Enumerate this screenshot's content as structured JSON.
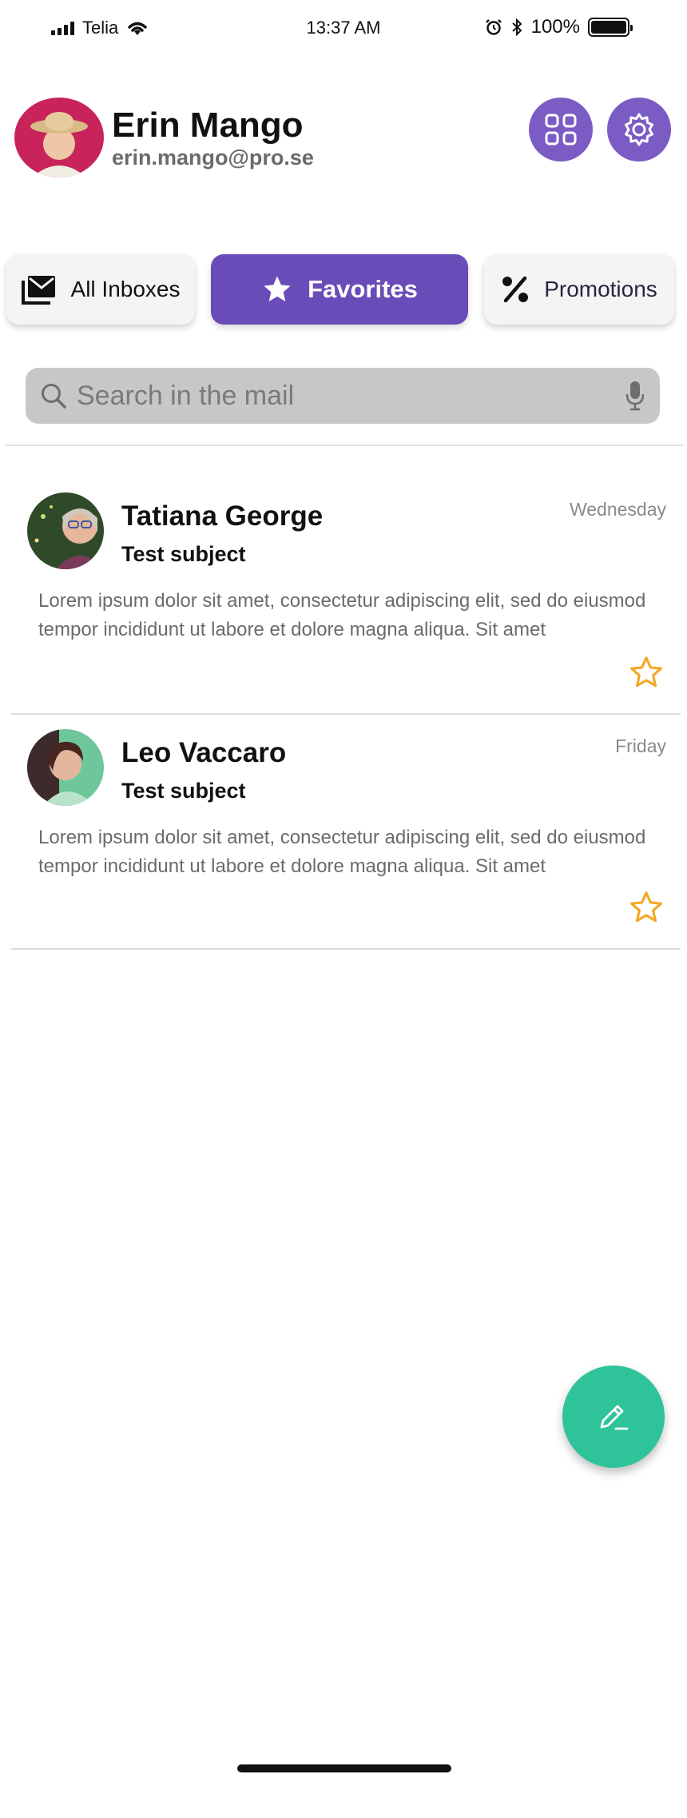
{
  "status_bar": {
    "carrier": "Telia",
    "time": "13:37 AM",
    "battery": "100%",
    "battery_level": 1.0
  },
  "header": {
    "name": "Erin Mango",
    "email": "erin.mango@pro.se",
    "icons": [
      "grid-icon",
      "gear-icon"
    ],
    "accent": "#7b5cc4"
  },
  "tabs": [
    {
      "label": "All Inboxes",
      "icon": "mail-inbox-icon",
      "active": false
    },
    {
      "label": "Favorites",
      "icon": "star-icon",
      "active": true
    },
    {
      "label": "Promotions",
      "icon": "percent-icon",
      "active": false
    }
  ],
  "search": {
    "placeholder": "Search in the mail",
    "value": ""
  },
  "mails": [
    {
      "sender": "Tatiana George",
      "subject": "Test subject",
      "date": "Wednesday",
      "preview": "Lorem ipsum dolor sit amet, consectetur adipiscing elit, sed do eiusmod tempor incididunt ut labore et dolore magna aliqua. Sit amet",
      "favorite": true
    },
    {
      "sender": "Leo Vaccaro",
      "subject": "Test subject",
      "date": "Friday",
      "preview": "Lorem ipsum dolor sit amet, consectetur adipiscing elit, sed do eiusmod tempor incididunt ut labore et dolore magna aliqua. Sit amet",
      "favorite": true
    }
  ],
  "colors": {
    "active_tab": "#6a4cb8",
    "fab": "#2fc39a",
    "star": "#f5a623"
  }
}
